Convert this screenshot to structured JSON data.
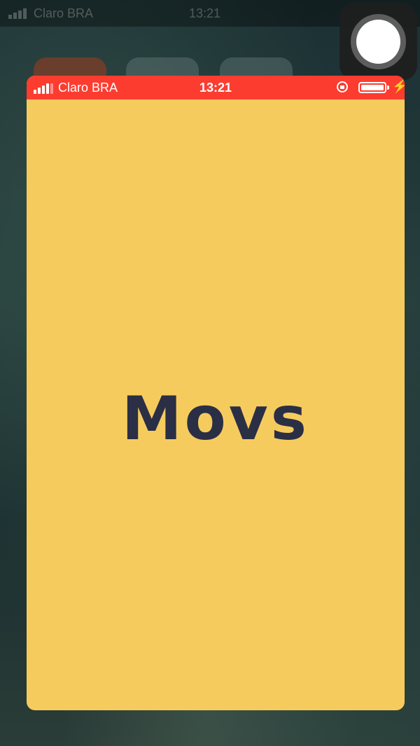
{
  "background": {
    "status_bar": {
      "carrier": "Claro BRA",
      "time": "13:21"
    },
    "wallpaper_color": "#1c3134"
  },
  "assistive_touch": {
    "icon": "assistive-touch-icon"
  },
  "app": {
    "status_bar": {
      "carrier": "Claro BRA",
      "time": "13:21",
      "background_color": "#fd3c30",
      "signal_bars": 4,
      "icons": [
        "signal-icon",
        "rotation-lock-icon",
        "battery-icon",
        "charging-icon"
      ]
    },
    "splash": {
      "logo_text": "Movs",
      "background_color": "#f6cb5e",
      "text_color": "#2b2f45"
    }
  }
}
